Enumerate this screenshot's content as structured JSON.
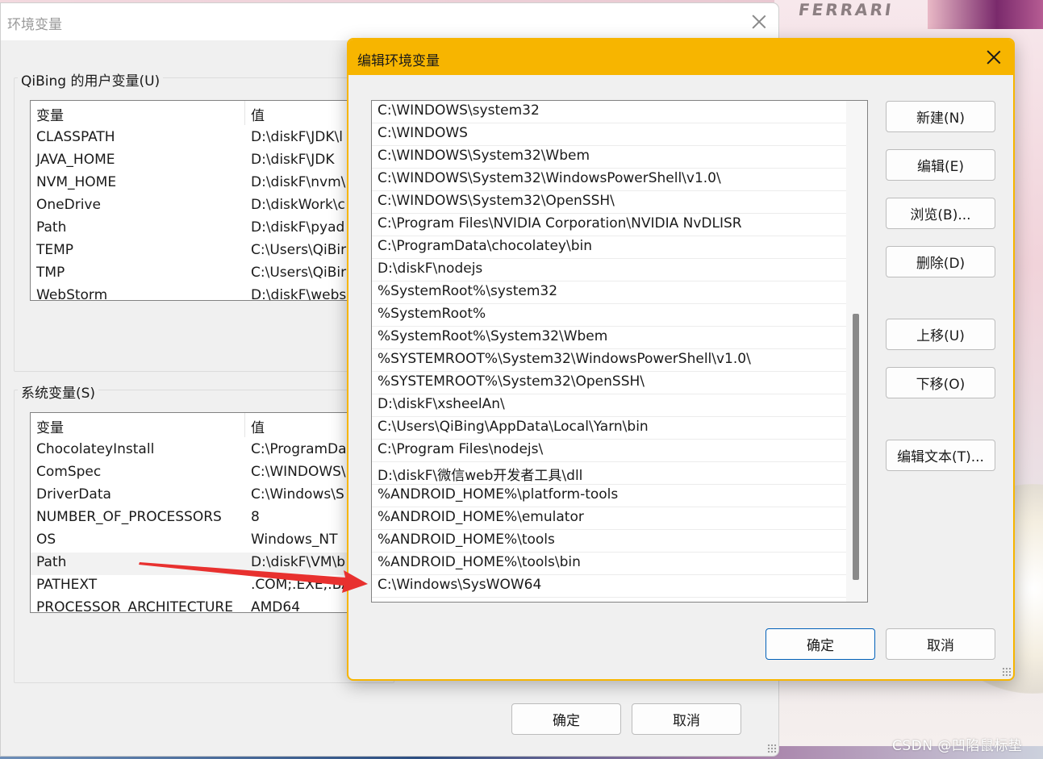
{
  "desktop": {
    "logo_text": "FERRARI",
    "watermark": "CSDN @凹陷鼠标垫"
  },
  "main_window": {
    "title": "环境变量",
    "user_group_label": "QiBing 的用户变量(U)",
    "system_group_label": "系统变量(S)",
    "column_variable": "变量",
    "column_value": "值",
    "user_vars": [
      {
        "name": "CLASSPATH",
        "value": "D:\\diskF\\JDK\\l"
      },
      {
        "name": "JAVA_HOME",
        "value": "D:\\diskF\\JDK"
      },
      {
        "name": "NVM_HOME",
        "value": "D:\\diskF\\nvm\\"
      },
      {
        "name": "OneDrive",
        "value": "D:\\diskWork\\c"
      },
      {
        "name": "Path",
        "value": "D:\\diskF\\pyad"
      },
      {
        "name": "TEMP",
        "value": "C:\\Users\\QiBir"
      },
      {
        "name": "TMP",
        "value": "C:\\Users\\QiBir"
      },
      {
        "name": "WebStorm",
        "value": "D:\\diskF\\webs"
      }
    ],
    "system_vars": [
      {
        "name": "ChocolateyInstall",
        "value": "C:\\ProgramDa"
      },
      {
        "name": "ComSpec",
        "value": "C:\\WINDOWS\\"
      },
      {
        "name": "DriverData",
        "value": "C:\\Windows\\S"
      },
      {
        "name": "NUMBER_OF_PROCESSORS",
        "value": "8"
      },
      {
        "name": "OS",
        "value": "Windows_NT"
      },
      {
        "name": "Path",
        "value": "D:\\diskF\\VM\\b"
      },
      {
        "name": "PATHEXT",
        "value": ".COM;.EXE;.BA"
      },
      {
        "name": "PROCESSOR_ARCHITECTURE",
        "value": "AMD64"
      }
    ],
    "ok_label": "确定",
    "cancel_label": "取消"
  },
  "edit_dialog": {
    "title": "编辑环境变量",
    "paths": [
      "C:\\WINDOWS\\system32",
      "C:\\WINDOWS",
      "C:\\WINDOWS\\System32\\Wbem",
      "C:\\WINDOWS\\System32\\WindowsPowerShell\\v1.0\\",
      "C:\\WINDOWS\\System32\\OpenSSH\\",
      "C:\\Program Files\\NVIDIA Corporation\\NVIDIA NvDLISR",
      "C:\\ProgramData\\chocolatey\\bin",
      "D:\\diskF\\nodejs",
      "%SystemRoot%\\system32",
      "%SystemRoot%",
      "%SystemRoot%\\System32\\Wbem",
      "%SYSTEMROOT%\\System32\\WindowsPowerShell\\v1.0\\",
      "%SYSTEMROOT%\\System32\\OpenSSH\\",
      "D:\\diskF\\xsheelAn\\",
      "C:\\Users\\QiBing\\AppData\\Local\\Yarn\\bin",
      "C:\\Program Files\\nodejs\\",
      "D:\\diskF\\微信web开发者工具\\dll",
      "%ANDROID_HOME%\\platform-tools",
      "%ANDROID_HOME%\\emulator",
      "%ANDROID_HOME%\\tools",
      "%ANDROID_HOME%\\tools\\bin",
      "C:\\Windows\\SysWOW64"
    ],
    "buttons": {
      "new": "新建(N)",
      "edit": "编辑(E)",
      "browse": "浏览(B)...",
      "delete": "删除(D)",
      "move_up": "上移(U)",
      "move_down": "下移(O)",
      "edit_text": "编辑文本(T)...",
      "ok": "确定",
      "cancel": "取消"
    }
  },
  "colors": {
    "dialog_accent": "#f7b500",
    "arrow": "#e8312f",
    "default_button_border": "#005fb8"
  }
}
